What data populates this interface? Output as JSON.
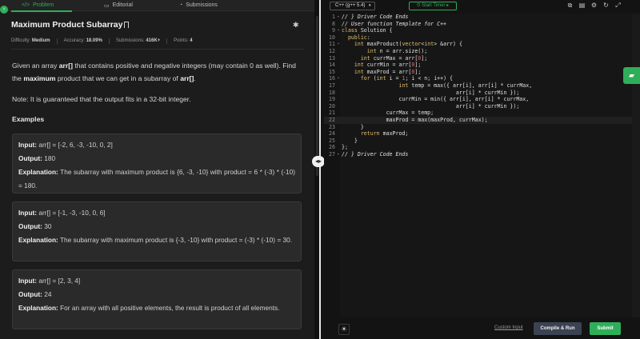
{
  "tabs": {
    "problem": "Problem",
    "editorial": "Editorial",
    "submissions": "Submissions"
  },
  "problem": {
    "title": "Maximum Product Subarray",
    "meta": {
      "difficulty_label": "Difficulty:",
      "difficulty": "Medium",
      "accuracy_label": "Accuracy:",
      "accuracy": "18.09%",
      "submissions_label": "Submissions:",
      "submissions": "416K+",
      "points_label": "Points:",
      "points": "4"
    },
    "desc_1": "Given an array ",
    "desc_arr": "arr[]",
    "desc_2": " that contains positive and negative integers (may contain 0 as well). Find the ",
    "desc_max": "maximum",
    "desc_3": " product that we can get in a subarray of ",
    "desc_arr2": "arr[]",
    "desc_4": ".",
    "note": "Note: It is guaranteed that the output fits in a 32-bit integer.",
    "examples_heading": "Examples",
    "examples": [
      {
        "input_label": "Input:",
        "input": " arr[] = [-2, 6, -3, -10, 0, 2]",
        "output_label": "Output:",
        "output": " 180",
        "explanation_label": "Explanation:",
        "explanation": " The subarray with maximum product is {6, -3, -10} with product = 6 * (-3) * (-10) = 180."
      },
      {
        "input_label": "Input:",
        "input": " arr[] = [-1, -3, -10, 0, 6]",
        "output_label": "Output:",
        "output": " 30",
        "explanation_label": "Explanation:",
        "explanation": " The subarray with maximum product is {-3, -10} with product = (-3) * (-10) = 30."
      },
      {
        "input_label": "Input:",
        "input": " arr[] = [2, 3, 4]",
        "output_label": "Output:",
        "output": " 24",
        "explanation_label": "Explanation:",
        "explanation": " For an array with all positive elements, the result is product of all elements."
      }
    ]
  },
  "editor": {
    "language": "C++ (g++ 5.4)",
    "timer_label": "Start Timer",
    "lines": [
      {
        "n": "1",
        "fold": "▸",
        "t": "// } Driver Code Ends",
        "cls": "c-cm",
        "fb": true
      },
      {
        "n": "8",
        "fold": "",
        "t": "// User function Template for C++",
        "cls": "c-cm"
      },
      {
        "n": "9",
        "fold": "▾",
        "t": "class Solution {",
        "cls": ""
      },
      {
        "n": "10",
        "fold": "",
        "t": "  public:",
        "cls": ""
      },
      {
        "n": "11",
        "fold": "▾",
        "t": "    int maxProduct(vector<int> &arr) {",
        "cls": ""
      },
      {
        "n": "12",
        "fold": "",
        "t": "        int n = arr.size();",
        "cls": ""
      },
      {
        "n": "13",
        "fold": "",
        "t": "      int currMax = arr[0];",
        "cls": ""
      },
      {
        "n": "14",
        "fold": "",
        "t": "    int currMin = arr[0];",
        "cls": ""
      },
      {
        "n": "15",
        "fold": "",
        "t": "    int maxProd = arr[0];",
        "cls": ""
      },
      {
        "n": "16",
        "fold": "▾",
        "t": "      for (int i = 1; i < n; i++) {",
        "cls": ""
      },
      {
        "n": "17",
        "fold": "",
        "t": "                  int temp = max({ arr[i], arr[i] * currMax,",
        "cls": ""
      },
      {
        "n": "18",
        "fold": "",
        "t": "                                    arr[i] * currMin });",
        "cls": ""
      },
      {
        "n": "19",
        "fold": "",
        "t": "                  currMin = min({ arr[i], arr[i] * currMax,",
        "cls": ""
      },
      {
        "n": "20",
        "fold": "",
        "t": "                                    arr[i] * currMin });",
        "cls": ""
      },
      {
        "n": "21",
        "fold": "",
        "t": "              currMax = temp;",
        "cls": ""
      },
      {
        "n": "22",
        "fold": "",
        "t": "              maxProd = max(maxProd, currMax);",
        "cls": "",
        "hl": true
      },
      {
        "n": "23",
        "fold": "",
        "t": "      }",
        "cls": ""
      },
      {
        "n": "24",
        "fold": "",
        "t": "      return maxProd;",
        "cls": ""
      },
      {
        "n": "25",
        "fold": "",
        "t": "    }",
        "cls": ""
      },
      {
        "n": "26",
        "fold": "",
        "t": "};",
        "cls": ""
      },
      {
        "n": "27",
        "fold": "▸",
        "t": "// } Driver Code Ends",
        "cls": "c-cm",
        "fb": true
      }
    ]
  },
  "bottom": {
    "custom_input": "Custom Input",
    "compile": "Compile & Run",
    "submit": "Submit"
  },
  "colors": {
    "accent": "#2fae5a",
    "compile_bg": "#3b4252"
  },
  "icons": [
    "collapse-icon",
    "book-icon",
    "pencil-icon",
    "history-icon",
    "bookmark-icon",
    "bug-icon",
    "drag-icon",
    "chat-icon",
    "bulb-icon",
    "copy-icon",
    "paste-icon",
    "settings-icon",
    "reset-icon",
    "fullscreen-icon",
    "timer-icon"
  ]
}
